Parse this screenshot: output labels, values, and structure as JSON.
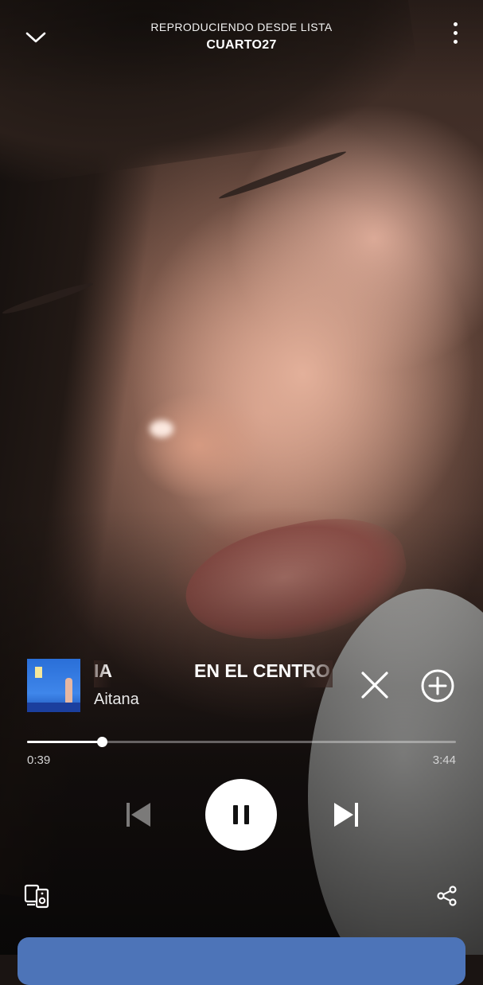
{
  "header": {
    "context_label": "REPRODUCIENDO DESDE LISTA",
    "context_name": "CUARTO27",
    "collapse_icon": "chevron-down-icon",
    "more_icon": "more-vertical-icon"
  },
  "track": {
    "title_fragment": "IA",
    "title": "EN EL CENTRO",
    "artist": "Aitana",
    "hide_icon": "close-icon",
    "add_icon": "add-circle-icon"
  },
  "playback": {
    "elapsed": "0:39",
    "duration": "3:44",
    "progress_fraction": 0.174,
    "is_playing": true
  },
  "controls": {
    "previous_icon": "skip-previous-icon",
    "pause_icon": "pause-icon",
    "next_icon": "skip-next-icon"
  },
  "footer": {
    "devices_icon": "connect-devices-icon",
    "share_icon": "share-icon"
  },
  "colors": {
    "accent_lyrics_card": "#4d74b8",
    "progress_fill": "#ffffff",
    "progress_track": "rgba(255,255,255,0.35)"
  }
}
